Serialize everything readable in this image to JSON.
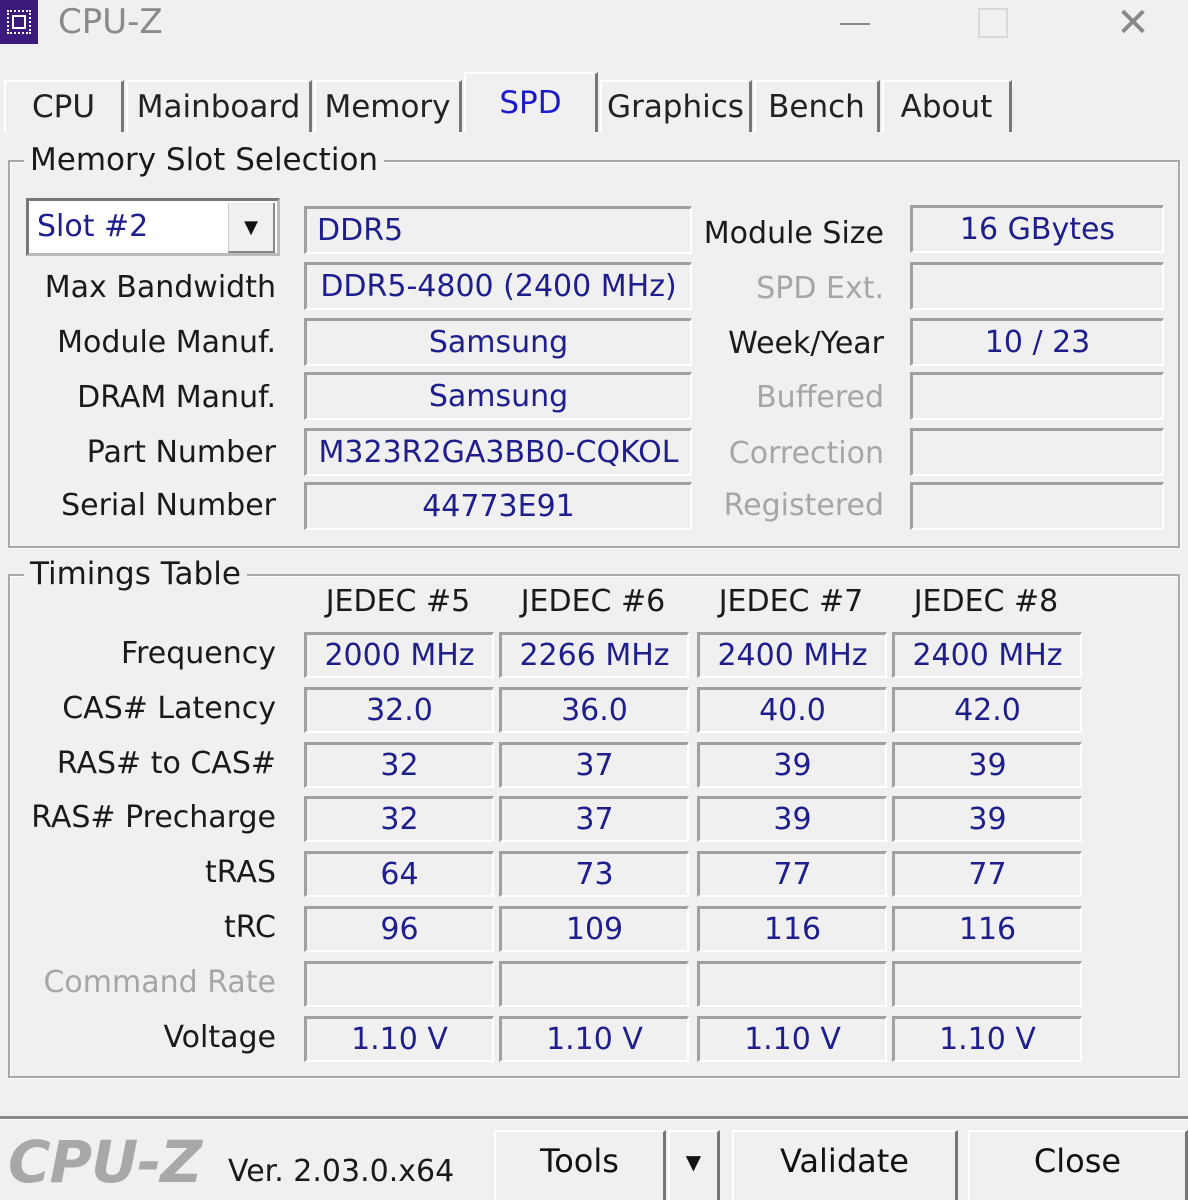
{
  "window": {
    "title": "CPU-Z",
    "icons": {
      "app": "cpu-chip-icon",
      "minimize": "minimize-icon",
      "maximize": "maximize-icon",
      "close": "close-icon"
    },
    "close_glyph": "✕"
  },
  "tabs": [
    {
      "label": "CPU",
      "active": false
    },
    {
      "label": "Mainboard",
      "active": false
    },
    {
      "label": "Memory",
      "active": false
    },
    {
      "label": "SPD",
      "active": true
    },
    {
      "label": "Graphics",
      "active": false
    },
    {
      "label": "Bench",
      "active": false
    },
    {
      "label": "About",
      "active": false
    }
  ],
  "slot_section": {
    "title": "Memory Slot Selection",
    "slot_selected": "Slot #2",
    "dropdown_glyph": "▼",
    "memory_type": "DDR5",
    "left_fields": [
      {
        "label": "Max Bandwidth",
        "value": "DDR5-4800 (2400 MHz)",
        "enabled": true
      },
      {
        "label": "Module Manuf.",
        "value": "Samsung",
        "enabled": true
      },
      {
        "label": "DRAM Manuf.",
        "value": "Samsung",
        "enabled": true
      },
      {
        "label": "Part Number",
        "value": "M323R2GA3BB0-CQKOL",
        "enabled": true
      },
      {
        "label": "Serial Number",
        "value": "44773E91",
        "enabled": true
      }
    ],
    "right_fields": [
      {
        "label": "Module Size",
        "value": "16 GBytes",
        "enabled": true
      },
      {
        "label": "SPD Ext.",
        "value": "",
        "enabled": false
      },
      {
        "label": "Week/Year",
        "value": "10 / 23",
        "enabled": true
      },
      {
        "label": "Buffered",
        "value": "",
        "enabled": false
      },
      {
        "label": "Correction",
        "value": "",
        "enabled": false
      },
      {
        "label": "Registered",
        "value": "",
        "enabled": false
      }
    ]
  },
  "timings": {
    "title": "Timings Table",
    "columns": [
      "JEDEC #5",
      "JEDEC #6",
      "JEDEC #7",
      "JEDEC #8"
    ],
    "rows": [
      {
        "label": "Frequency",
        "enabled": true,
        "values": [
          "2000 MHz",
          "2266 MHz",
          "2400 MHz",
          "2400 MHz"
        ]
      },
      {
        "label": "CAS# Latency",
        "enabled": true,
        "values": [
          "32.0",
          "36.0",
          "40.0",
          "42.0"
        ]
      },
      {
        "label": "RAS# to CAS#",
        "enabled": true,
        "values": [
          "32",
          "37",
          "39",
          "39"
        ]
      },
      {
        "label": "RAS# Precharge",
        "enabled": true,
        "values": [
          "32",
          "37",
          "39",
          "39"
        ]
      },
      {
        "label": "tRAS",
        "enabled": true,
        "values": [
          "64",
          "73",
          "77",
          "77"
        ]
      },
      {
        "label": "tRC",
        "enabled": true,
        "values": [
          "96",
          "109",
          "116",
          "116"
        ]
      },
      {
        "label": "Command Rate",
        "enabled": false,
        "values": [
          "",
          "",
          "",
          ""
        ]
      },
      {
        "label": "Voltage",
        "enabled": true,
        "values": [
          "1.10 V",
          "1.10 V",
          "1.10 V",
          "1.10 V"
        ]
      }
    ]
  },
  "footer": {
    "logo": "CPU-Z",
    "version": "Ver. 2.03.0.x64",
    "tools_label": "Tools",
    "tools_arrow": "▼",
    "validate_label": "Validate",
    "close_label": "Close"
  }
}
